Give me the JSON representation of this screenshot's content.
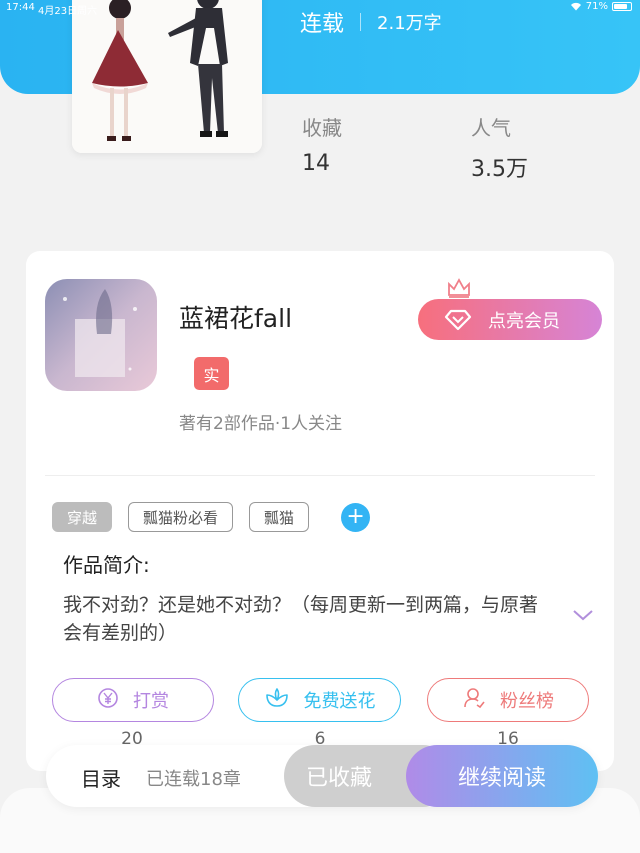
{
  "status_bar": {
    "time": "17:44",
    "date": "4月23日周六",
    "battery": "71%"
  },
  "book": {
    "status": "连载",
    "word_count": "2.1万字"
  },
  "stats": [
    {
      "label": "收藏",
      "value": "14"
    },
    {
      "label": "人气",
      "value": "3.5万"
    }
  ],
  "author": {
    "name": "蓝裙花fall",
    "badge": "实",
    "meta": "著有2部作品·1人关注",
    "vip_button": "点亮会员"
  },
  "tags": [
    "穿越",
    "瓢猫粉必看",
    "瓢猫"
  ],
  "intro": {
    "title": "作品简介:",
    "text": "我不对劲？还是她不对劲？（每周更新一到两篇，与原著会有差别的）"
  },
  "actions": [
    {
      "label": "打赏",
      "count": "20",
      "color": "#b486e0",
      "icon": "yen-icon"
    },
    {
      "label": "免费送花",
      "count": "6",
      "color": "#37c0ef",
      "icon": "flower-icon"
    },
    {
      "label": "粉丝榜",
      "count": "16",
      "color": "#ee7a7a",
      "icon": "user-icon"
    }
  ],
  "bottom": {
    "toc": "目录",
    "progress": "已连载18章",
    "collected": "已收藏",
    "continue": "继续阅读"
  }
}
